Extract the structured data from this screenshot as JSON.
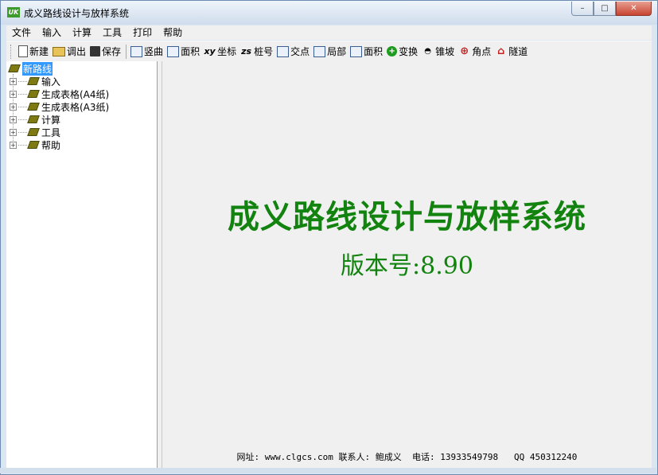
{
  "window": {
    "title": "成义路线设计与放样系统",
    "app_icon_text": "UK",
    "controls": {
      "minimize": "–",
      "maximize": "□",
      "close": "✕"
    }
  },
  "menu": [
    "文件",
    "输入",
    "计算",
    "工具",
    "打印",
    "帮助"
  ],
  "toolbar": [
    {
      "icon": "new-doc-icon",
      "label": "新建"
    },
    {
      "icon": "folder-open-icon",
      "label": "调出"
    },
    {
      "icon": "save-icon",
      "label": "保存"
    },
    {
      "icon": "vertical-curve-icon",
      "label": "竖曲"
    },
    {
      "icon": "area-icon",
      "label": "面积"
    },
    {
      "icon": "xy-coordinate-icon",
      "label": "坐标",
      "glyph": "xy"
    },
    {
      "icon": "zs-station-icon",
      "label": "桩号",
      "glyph": "zs"
    },
    {
      "icon": "intersection-icon",
      "label": "交点"
    },
    {
      "icon": "local-icon",
      "label": "局部"
    },
    {
      "icon": "area2-icon",
      "label": "面积"
    },
    {
      "icon": "transform-icon",
      "label": "变换"
    },
    {
      "icon": "cone-slope-icon",
      "label": "锥坡"
    },
    {
      "icon": "angle-point-icon",
      "label": "角点"
    },
    {
      "icon": "tunnel-icon",
      "label": "隧道"
    }
  ],
  "tree": {
    "root": "新路线",
    "items": [
      "输入",
      "生成表格(A4纸)",
      "生成表格(A3纸)",
      "计算",
      "工具",
      "帮助"
    ]
  },
  "main": {
    "title": "成义路线设计与放样系统",
    "version": "版本号:8.90",
    "footer": "网址: www.clgcs.com 联系人: 鲍成义  电话: 13933549798   QQ 450312240"
  },
  "colors": {
    "accent_green": "#12830f",
    "selection": "#3399ff"
  }
}
